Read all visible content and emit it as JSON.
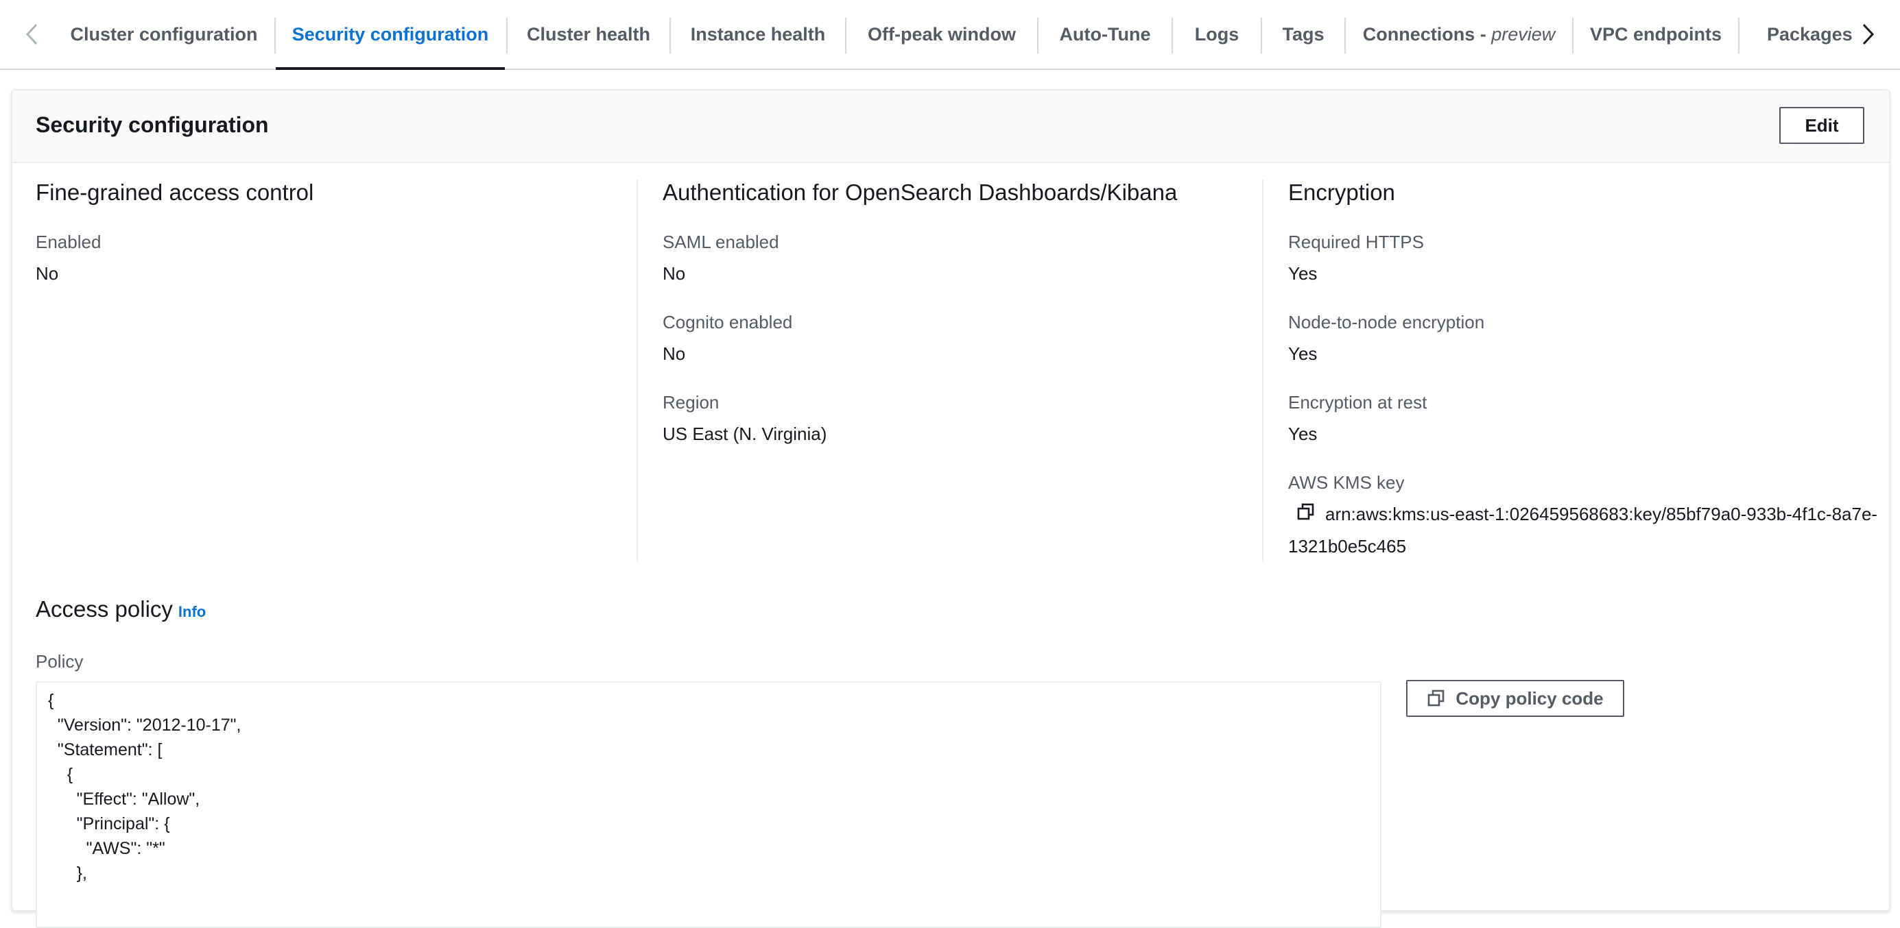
{
  "tabs": [
    {
      "label": "Cluster configuration",
      "suffix": ""
    },
    {
      "label": "Security configuration",
      "suffix": ""
    },
    {
      "label": "Cluster health",
      "suffix": ""
    },
    {
      "label": "Instance health",
      "suffix": ""
    },
    {
      "label": "Off-peak window",
      "suffix": ""
    },
    {
      "label": "Auto-Tune",
      "suffix": ""
    },
    {
      "label": "Logs",
      "suffix": ""
    },
    {
      "label": "Tags",
      "suffix": ""
    },
    {
      "label": "Connections - ",
      "suffix": "preview"
    },
    {
      "label": "VPC endpoints",
      "suffix": ""
    },
    {
      "label": "Packages",
      "suffix": ""
    }
  ],
  "active_tab": "Security configuration",
  "section": {
    "title": "Security configuration",
    "edit_label": "Edit"
  },
  "fgac": {
    "title": "Fine-grained access control",
    "enabled_label": "Enabled",
    "enabled_value": "No"
  },
  "auth": {
    "title": "Authentication for OpenSearch Dashboards/Kibana",
    "saml_label": "SAML enabled",
    "saml_value": "No",
    "cognito_label": "Cognito enabled",
    "cognito_value": "No",
    "region_label": "Region",
    "region_value": "US East (N. Virginia)"
  },
  "encryption": {
    "title": "Encryption",
    "https_label": "Required HTTPS",
    "https_value": "Yes",
    "n2n_label": "Node-to-node encryption",
    "n2n_value": "Yes",
    "rest_label": "Encryption at rest",
    "rest_value": "Yes",
    "kms_label": "AWS KMS key",
    "kms_value": "arn:aws:kms:us-east-1:026459568683:key/85bf79a0-933b-4f1c-8a7e-1321b0e5c465"
  },
  "access_policy": {
    "title": "Access policy",
    "info_label": "Info",
    "policy_label": "Policy",
    "policy_code": "{\n  \"Version\": \"2012-10-17\",\n  \"Statement\": [\n    {\n      \"Effect\": \"Allow\",\n      \"Principal\": {\n        \"AWS\": \"*\"\n      },",
    "copy_label": "Copy policy code"
  },
  "colors": {
    "accent": "#0972d3",
    "text": "#16191f",
    "label": "#545b64",
    "border": "#eaeded",
    "header_bg": "#fafafa"
  },
  "icons": {
    "scroll_left": "chevron-left-icon",
    "scroll_right": "chevron-right-icon",
    "copy": "copy-icon"
  }
}
